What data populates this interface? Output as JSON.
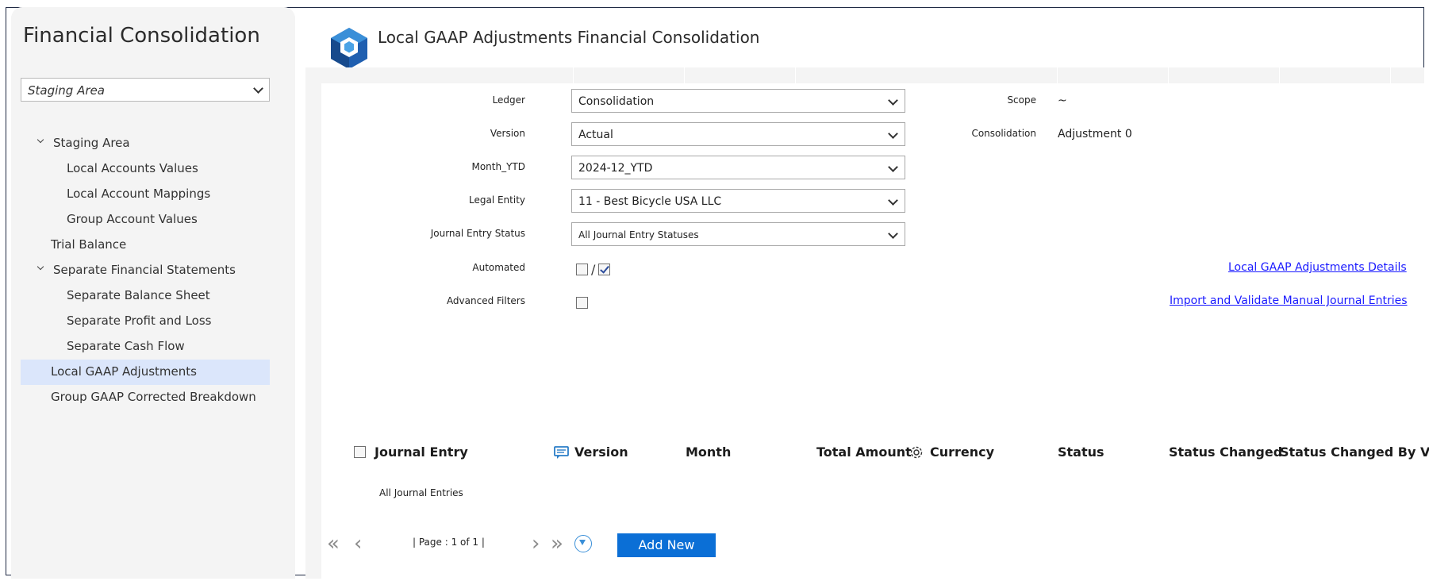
{
  "sidebar": {
    "app_title": "Financial Consolidation",
    "area_select": "Staging Area",
    "items": [
      {
        "label": "Staging Area",
        "expandable": true
      },
      {
        "label": "Local Accounts Values"
      },
      {
        "label": "Local Account Mappings"
      },
      {
        "label": "Group Account Values"
      },
      {
        "label": "Trial Balance"
      },
      {
        "label": "Separate Financial Statements",
        "expandable": true
      },
      {
        "label": "Separate Balance Sheet"
      },
      {
        "label": "Separate Profit and Loss"
      },
      {
        "label": "Separate Cash Flow"
      },
      {
        "label": "Local GAAP Adjustments",
        "active": true
      },
      {
        "label": "Group GAAP Corrected Breakdown"
      }
    ]
  },
  "header": {
    "title": "Local GAAP Adjustments Financial Consolidation",
    "logo_icon": "cube-logo-icon"
  },
  "form": {
    "ledger_label": "Ledger",
    "ledger_value": "Consolidation",
    "version_label": "Version",
    "version_value": "Actual",
    "month_label": "Month_YTD",
    "month_value": "2024-12_YTD",
    "entity_label": "Legal Entity",
    "entity_value": "11 - Best Bicycle USA LLC",
    "status_label": "Journal Entry Status",
    "status_value": "All Journal Entry Statuses",
    "automated_label": "Automated",
    "automated_slash": "/",
    "advanced_label": "Advanced Filters",
    "scope_label": "Scope",
    "scope_value": "~",
    "consolidation_label": "Consolidation",
    "consolidation_value": "Adjustment 0"
  },
  "links": {
    "details": "Local GAAP Adjustments Details",
    "import": "Import and Validate Manual Journal Entries"
  },
  "table": {
    "columns": [
      "Journal Entry",
      "Version",
      "Month",
      "Total Amount",
      "Currency",
      "Status",
      "Status Changed",
      "Status Changed By Valid"
    ],
    "rows": [
      "All Journal Entries"
    ]
  },
  "pager": {
    "page_info": "| Page : 1 of 1 |",
    "add_new": "Add New"
  },
  "colors": {
    "accent": "#0b6fd6",
    "active_nav": "#dbe6fb",
    "link": "#1a1aff"
  }
}
